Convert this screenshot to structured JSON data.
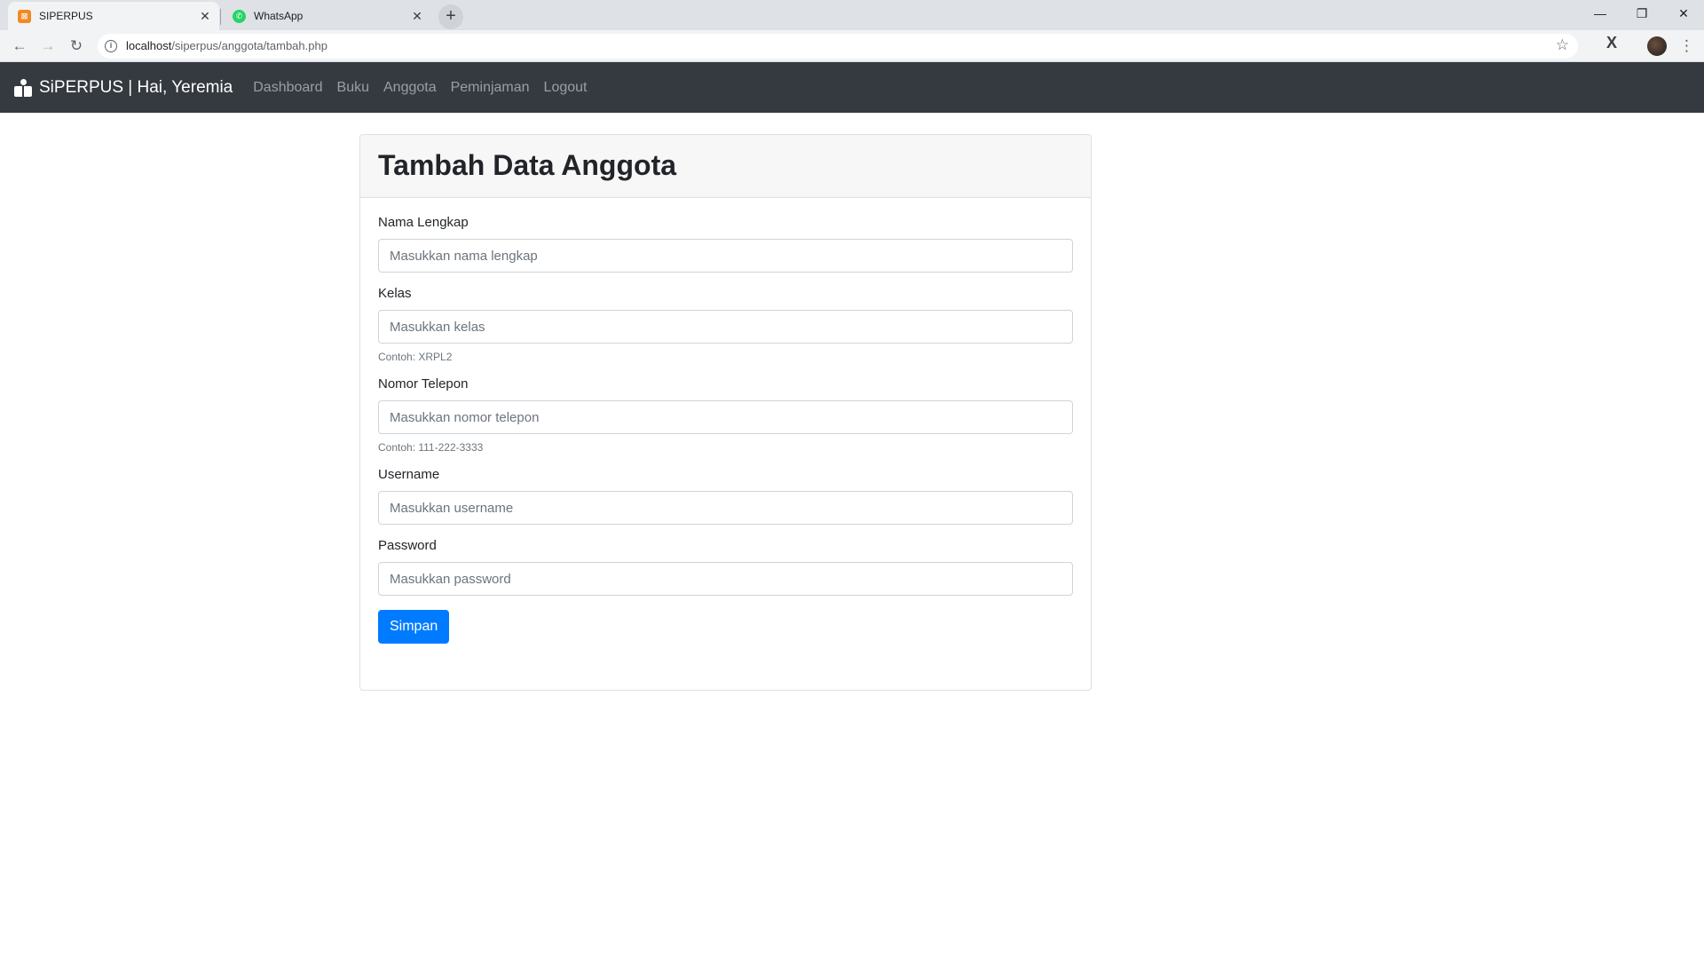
{
  "browser": {
    "tabs": [
      {
        "title": "SIPERPUS",
        "active": true,
        "favicon": "xampp-icon"
      },
      {
        "title": "WhatsApp",
        "active": false,
        "favicon": "whatsapp-icon"
      }
    ],
    "url_host": "localhost",
    "url_path": "/siperpus/anggota/tambah.php"
  },
  "navbar": {
    "brand": "SiPERPUS | Hai, Yeremia",
    "links": [
      "Dashboard",
      "Buku",
      "Anggota",
      "Peminjaman",
      "Logout"
    ]
  },
  "form": {
    "title": "Tambah Data Anggota",
    "fields": [
      {
        "label": "Nama Lengkap",
        "placeholder": "Masukkan nama lengkap",
        "help": ""
      },
      {
        "label": "Kelas",
        "placeholder": "Masukkan kelas",
        "help": "Contoh: XRPL2"
      },
      {
        "label": "Nomor Telepon",
        "placeholder": "Masukkan nomor telepon",
        "help": "Contoh: 111-222-3333"
      },
      {
        "label": "Username",
        "placeholder": "Masukkan username",
        "help": ""
      },
      {
        "label": "Password",
        "placeholder": "Masukkan password",
        "help": ""
      }
    ],
    "submit_label": "Simpan"
  },
  "colors": {
    "navbar_bg": "#343a40",
    "primary": "#007bff"
  }
}
